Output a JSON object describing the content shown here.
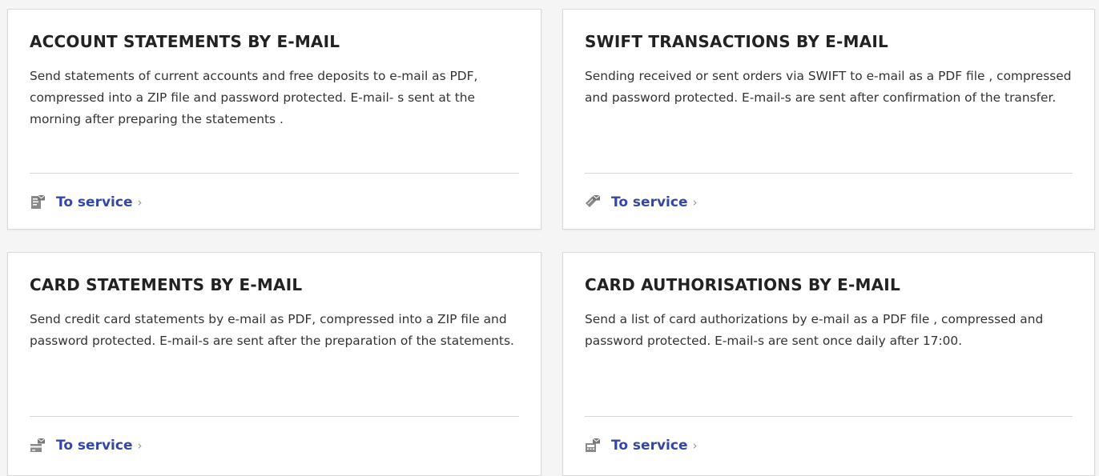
{
  "colors": {
    "link": "#3348a6",
    "title": "#222222",
    "text": "#333333",
    "icon": "#8a8a8a"
  },
  "cards": [
    {
      "title": "ACCOUNT STATEMENTS BY E-MAIL",
      "description": "Send statements of current accounts and free deposits to e-mail as PDF, compressed into a ZIP file and password protected. E-mail- s sent at the morning after preparing the statements .",
      "link_label": "To service",
      "icon": "document-mail-icon"
    },
    {
      "title": "SWIFT TRANSACTIONS BY E-MAIL",
      "description": "Sending received or sent orders via SWIFT to e-mail as a PDF file , compressed and password protected. E-mail-s are sent after confirmation of the transfer.",
      "link_label": "To service",
      "icon": "tag-mail-icon"
    },
    {
      "title": "CARD STATEMENTS BY E-MAIL",
      "description": "Send credit card statements by e-mail as PDF, compressed into a ZIP file and password protected. E-mail-s are sent after the preparation of the statements.",
      "link_label": "To service",
      "icon": "card-mail-icon"
    },
    {
      "title": "CARD AUTHORISATIONS BY E-MAIL",
      "description": "Send a list of card authorizations by e-mail as a PDF file , compressed and password protected. E-mail-s are sent once daily after 17:00.",
      "link_label": "To service",
      "icon": "card-terminal-mail-icon"
    }
  ]
}
